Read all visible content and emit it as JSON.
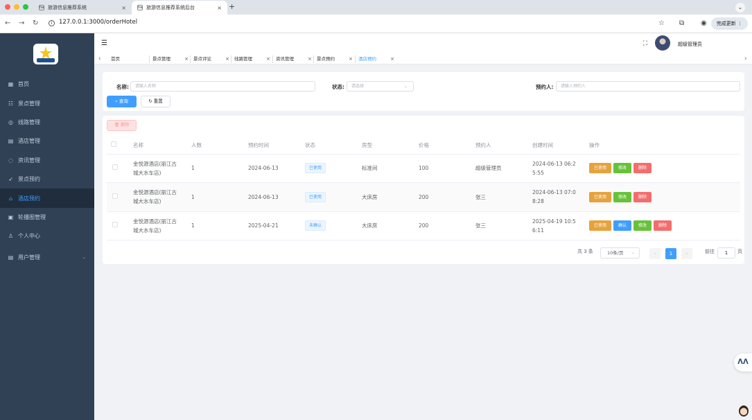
{
  "browser": {
    "tabs": [
      {
        "title": "旅游信息推荐系统",
        "active": false
      },
      {
        "title": "旅游信息推荐系统后台",
        "active": true
      }
    ],
    "favicon_text": "ha",
    "new_tab": "+",
    "url": "127.0.0.1:3000/orderHotel",
    "update_label": "完成更新"
  },
  "sidebar": {
    "items": [
      {
        "label": "首页",
        "icon": "dashboard-icon",
        "glyph": "▦"
      },
      {
        "label": "景点管理",
        "icon": "scenic-icon",
        "glyph": "☷"
      },
      {
        "label": "线路管理",
        "icon": "route-icon",
        "glyph": "◎"
      },
      {
        "label": "酒店管理",
        "icon": "hotel-icon",
        "glyph": "▤"
      },
      {
        "label": "资讯管理",
        "icon": "news-icon",
        "glyph": "◌"
      },
      {
        "label": "景点预约",
        "icon": "send-icon",
        "glyph": "➶"
      },
      {
        "label": "酒店预约",
        "icon": "home-icon",
        "glyph": "⌂"
      },
      {
        "label": "轮播图管理",
        "icon": "picture-icon",
        "glyph": "▣"
      },
      {
        "label": "个人中心",
        "icon": "user-icon",
        "glyph": "♙"
      },
      {
        "label": "用户管理",
        "icon": "user-manage-icon",
        "glyph": "▤"
      }
    ]
  },
  "header": {
    "username": "超级管理员"
  },
  "tags": [
    {
      "label": "首页",
      "closable": false
    },
    {
      "label": "景点管理",
      "closable": true
    },
    {
      "label": "景点评论",
      "closable": true
    },
    {
      "label": "线路管理",
      "closable": true
    },
    {
      "label": "资讯管理",
      "closable": true
    },
    {
      "label": "景点预约",
      "closable": true
    },
    {
      "label": "酒店预约",
      "closable": true,
      "active": true
    }
  ],
  "search": {
    "name_label": "名称:",
    "name_placeholder": "请输入名称",
    "status_label": "状态:",
    "status_placeholder": "请选择",
    "booker_label": "预约人:",
    "booker_placeholder": "请输入预约人",
    "query_label": "查询",
    "reset_label": "重置"
  },
  "table": {
    "delete_label": "删除",
    "columns": [
      "名称",
      "人数",
      "预约时间",
      "状态",
      "房型",
      "价格",
      "预约人",
      "创建时间",
      "操作"
    ],
    "rows": [
      {
        "name": "金悦源酒店(丽江古城大水车店)",
        "people": "1",
        "date": "2024-06-13",
        "status": "已使用",
        "room": "标准间",
        "price": "100",
        "booker": "超级管理员",
        "created": "2024-06-13 06:25:55",
        "actions": [
          "已使用",
          "修改",
          "删除"
        ]
      },
      {
        "name": "金悦源酒店(丽江古城大水车店)",
        "people": "1",
        "date": "2024-06-13",
        "status": "已使用",
        "room": "大床房",
        "price": "200",
        "booker": "张三",
        "created": "2024-06-13 07:08:28",
        "actions": [
          "已使用",
          "修改",
          "删除"
        ]
      },
      {
        "name": "金悦源酒店(丽江古城大水车店)",
        "people": "1",
        "date": "2025-04-21",
        "status": "未确认",
        "room": "大床房",
        "price": "200",
        "booker": "张三",
        "created": "2025-04-19 10:56:11",
        "actions": [
          "已使用",
          "确认",
          "修改",
          "删除"
        ]
      }
    ]
  },
  "pagination": {
    "total": "共 3 条",
    "page_size": "10条/页",
    "current": "1",
    "goto": "前往",
    "page_unit": "页",
    "goto_value": "1"
  }
}
